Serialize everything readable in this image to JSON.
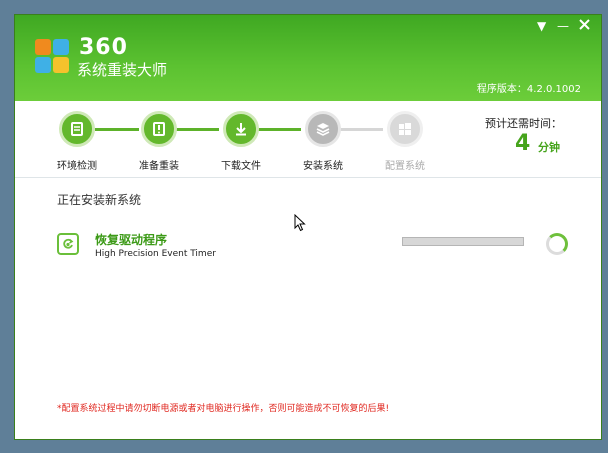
{
  "window": {
    "brand_number": "360",
    "brand_name": "系统重装大师",
    "version": "程序版本：4.2.0.1002"
  },
  "controls": {
    "menu_glyph": "▼",
    "minimize_glyph": "—"
  },
  "steps": [
    {
      "label": "环境检测",
      "status": "done",
      "icon": "monitor-icon"
    },
    {
      "label": "准备重装",
      "status": "done",
      "icon": "exclamation-icon"
    },
    {
      "label": "下载文件",
      "status": "done",
      "icon": "download-icon"
    },
    {
      "label": "安装系统",
      "status": "todo",
      "icon": "install-icon"
    },
    {
      "label": "配置系统",
      "status": "disabled",
      "icon": "windows-icon"
    }
  ],
  "remaining": {
    "title": "预计还需时间：",
    "number": "4",
    "unit": "分钟"
  },
  "main": {
    "section_title": "正在安装新系统",
    "task_title": "恢复驱动程序",
    "task_subtitle": "High Precision Event Timer",
    "progress": 1.0
  },
  "warning": "*配置系统过程中请勿切断电源或者对电脑进行操作，否则可能造成不可恢复的后果!",
  "colors": {
    "accent": "#5db22a",
    "warning": "#e0271f"
  }
}
